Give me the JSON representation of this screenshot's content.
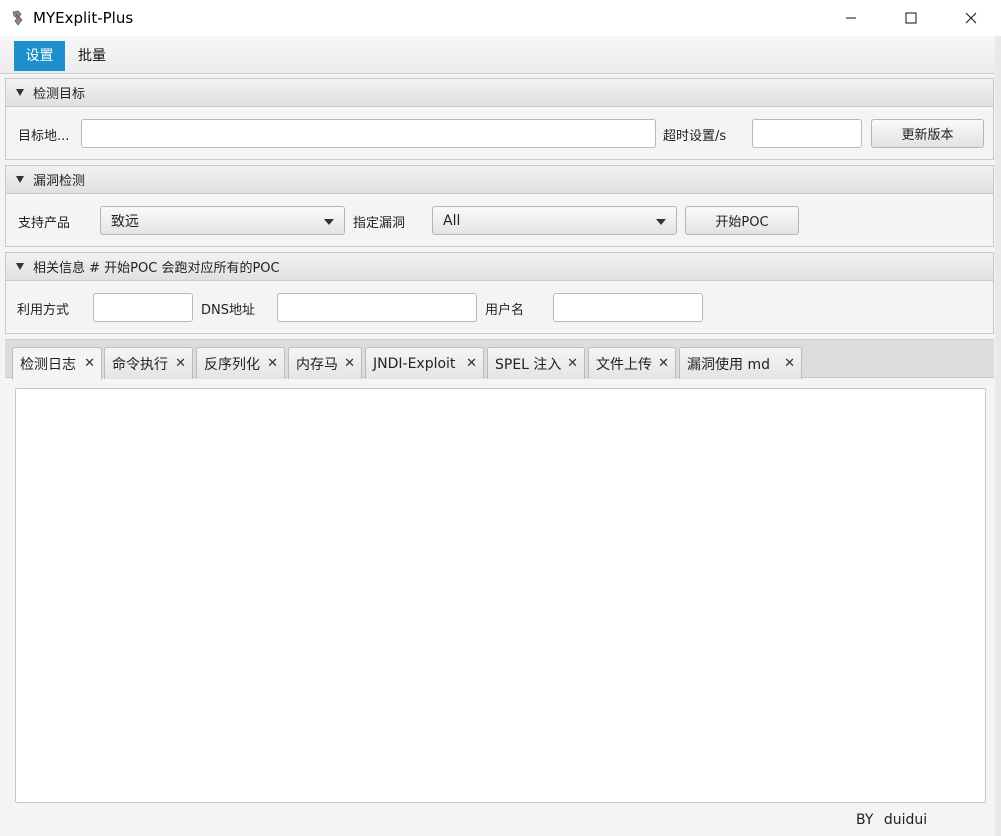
{
  "window": {
    "title": "MYExplit-Plus"
  },
  "menu": {
    "items": [
      "设置",
      "批量"
    ]
  },
  "target_pane": {
    "title": "检测目标",
    "address_label": "目标地...",
    "address_value": "",
    "timeout_label": "超时设置/s",
    "timeout_value": "",
    "update_button": "更新版本"
  },
  "vuln_pane": {
    "title": "漏洞检测",
    "product_label": "支持产品",
    "product_selected": "致远",
    "vuln_label": "指定漏洞",
    "vuln_selected": "All",
    "start_button": "开始POC"
  },
  "info_pane": {
    "title": "相关信息 # 开始POC 会跑对应所有的POC",
    "method_label": "利用方式",
    "method_value": "",
    "dns_label": "DNS地址",
    "dns_value": "",
    "user_label": "用户名",
    "user_value": ""
  },
  "tabs": [
    {
      "label": "检测日志",
      "close": "✕"
    },
    {
      "label": "命令执行",
      "close": "✕"
    },
    {
      "label": "反序列化",
      "close": "✕"
    },
    {
      "label": "内存马",
      "close": "✕"
    },
    {
      "label": "JNDI-Exploit",
      "close": "✕"
    },
    {
      "label": "SPEL 注入",
      "close": "✕"
    },
    {
      "label": "文件上传",
      "close": "✕"
    },
    {
      "label": "漏洞使用 md",
      "close": "✕"
    }
  ],
  "footer": {
    "text": "BY duidui"
  }
}
